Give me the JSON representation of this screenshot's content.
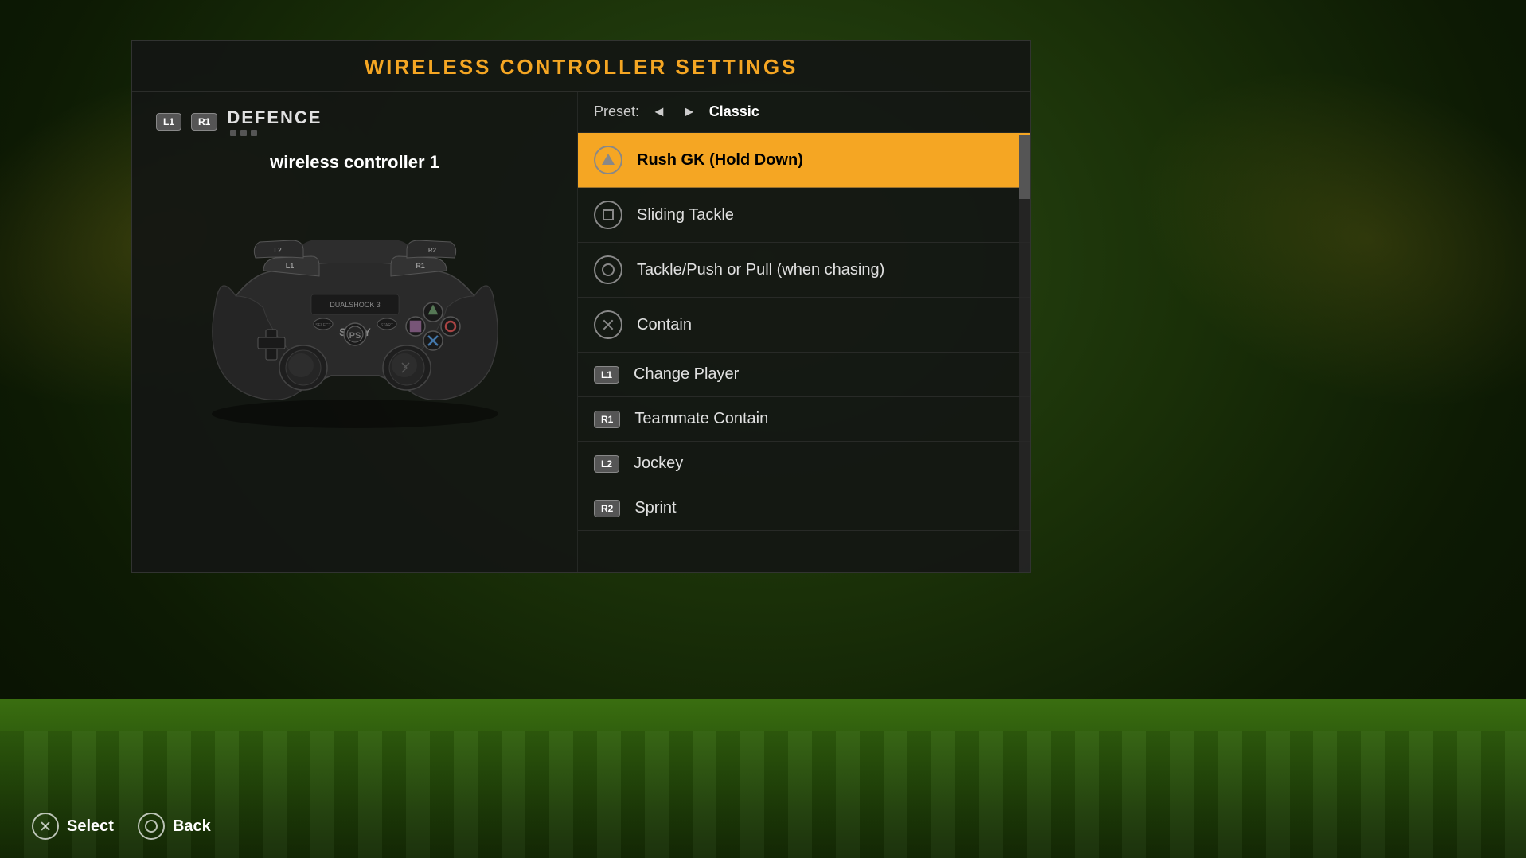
{
  "title": "WIRELESS CONTROLLER SETTINGS",
  "leftPanel": {
    "badge1": "L1",
    "badge2": "R1",
    "sectionTitle": "DEFENCE",
    "controllerName": "wireless controller 1"
  },
  "presetBar": {
    "label": "Preset:",
    "leftArrow": "◄",
    "rightArrow": "►",
    "value": "Classic"
  },
  "buttonList": [
    {
      "btnType": "triangle",
      "btnLabel": "△",
      "action": "Rush GK (Hold Down)",
      "active": true
    },
    {
      "btnType": "square",
      "btnLabel": "□",
      "action": "Sliding Tackle",
      "active": false
    },
    {
      "btnType": "circle-dot",
      "btnLabel": "⊙",
      "action": "Tackle/Push or Pull (when chasing)",
      "active": false
    },
    {
      "btnType": "cross",
      "btnLabel": "✕",
      "action": "Contain",
      "active": false
    },
    {
      "btnType": "l1",
      "btnLabel": "L1",
      "action": "Change Player",
      "active": false
    },
    {
      "btnType": "r1",
      "btnLabel": "R1",
      "action": "Teammate Contain",
      "active": false
    },
    {
      "btnType": "l2",
      "btnLabel": "L2",
      "action": "Jockey",
      "active": false
    },
    {
      "btnType": "r2",
      "btnLabel": "R2",
      "action": "Sprint",
      "active": false
    }
  ],
  "bottomBar": {
    "selectIcon": "cross",
    "selectLabel": "Select",
    "backIcon": "circle",
    "backLabel": "Back"
  }
}
